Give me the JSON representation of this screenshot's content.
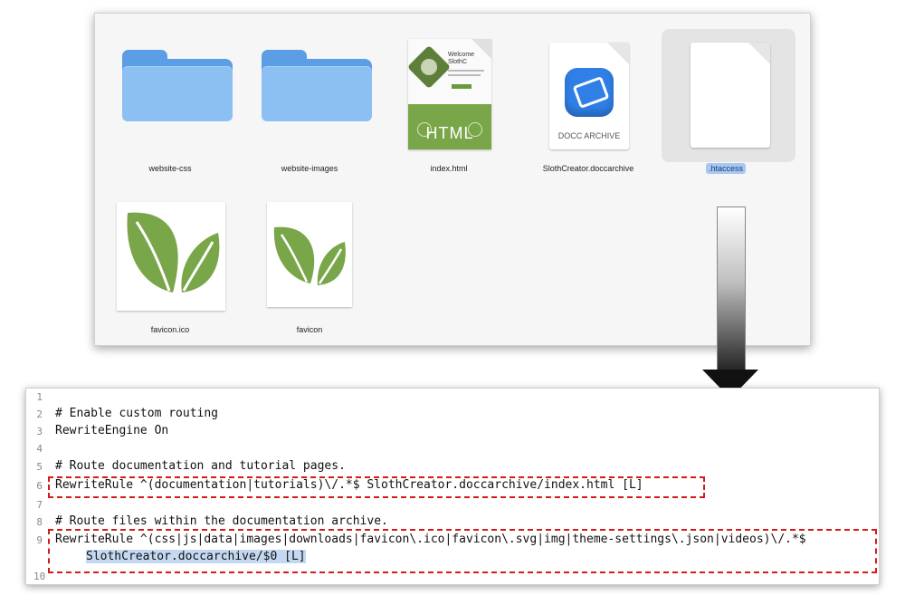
{
  "finder": {
    "items": [
      {
        "label": "website-css",
        "icon": "folder-icon"
      },
      {
        "label": "website-images",
        "icon": "folder-icon"
      },
      {
        "label": "index.html",
        "icon": "html-file-icon",
        "badge": "HTML",
        "preview_heading": "Welcome",
        "preview_sub": "SlothC"
      },
      {
        "label": "SlothCreator.doccarchive",
        "icon": "docc-archive-icon",
        "badge": "DOCC ARCHIVE"
      },
      {
        "label": ".htaccess",
        "icon": "blank-document-icon",
        "selected": true
      },
      {
        "label": "favicon.ico",
        "icon": "leaf-icon"
      },
      {
        "label": "favicon",
        "icon": "leaf-icon"
      }
    ]
  },
  "editor": {
    "lines": [
      {
        "n": "1",
        "text": ""
      },
      {
        "n": "2",
        "text": "# Enable custom routing"
      },
      {
        "n": "3",
        "text": "RewriteEngine On"
      },
      {
        "n": "4",
        "text": ""
      },
      {
        "n": "5",
        "text": "# Route documentation and tutorial pages."
      },
      {
        "n": "6",
        "text": "RewriteRule ^(documentation|tutorials)\\/.*$ SlothCreator.doccarchive/index.html [L]"
      },
      {
        "n": "7",
        "text": ""
      },
      {
        "n": "8",
        "text": "# Route files within the documentation archive."
      },
      {
        "n": "9",
        "text": "RewriteRule ^(css|js|data|images|downloads|favicon\\.ico|favicon\\.svg|img|theme-settings\\.json|videos)\\/.*$"
      },
      {
        "n": "",
        "text": "SlothCreator.doccarchive/$0 [L]"
      },
      {
        "n": "10",
        "text": ""
      }
    ]
  },
  "colors": {
    "highlight_box": "#d61a1a",
    "leaf": "#7aa64a",
    "folder": "#8cc0f3"
  }
}
